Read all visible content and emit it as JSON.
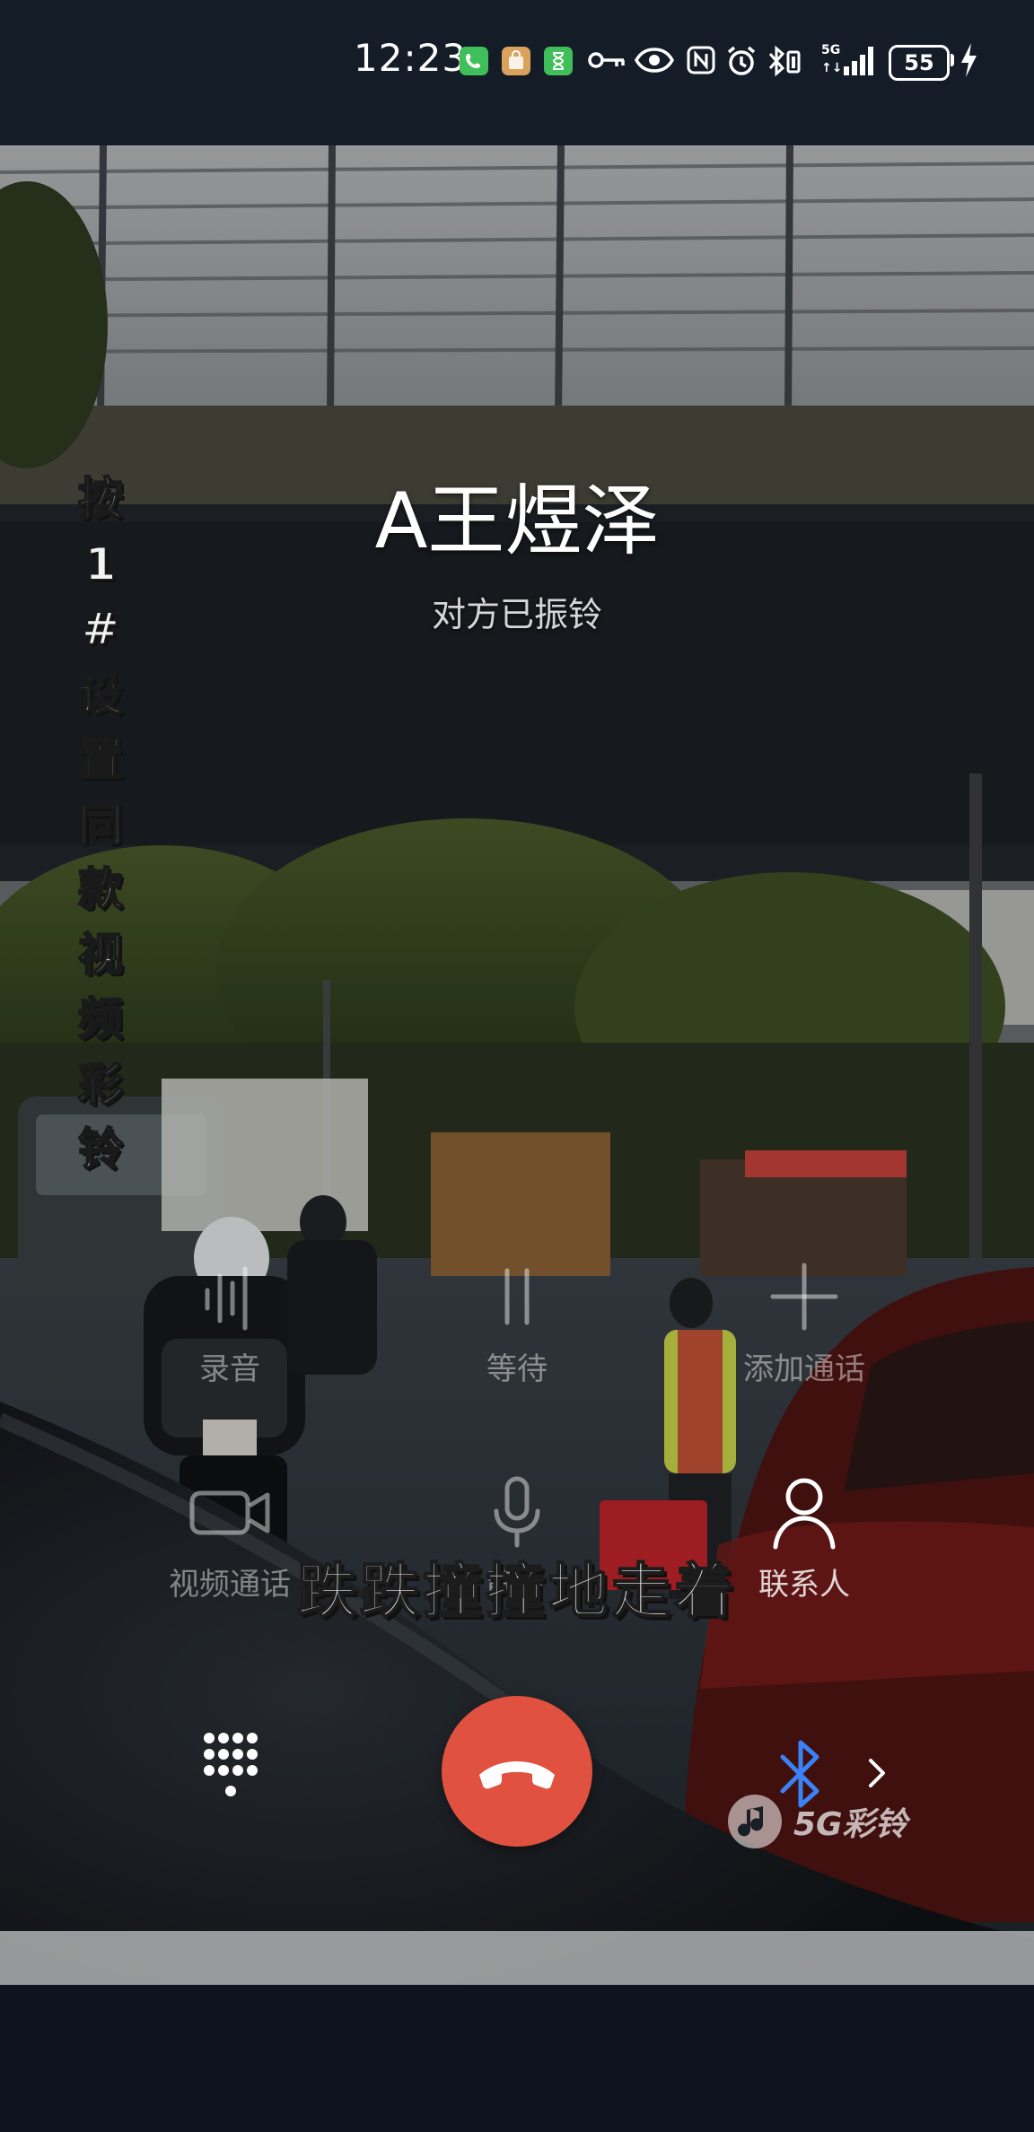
{
  "status_bar": {
    "time": "12:23",
    "network": "5G",
    "battery": "55"
  },
  "call": {
    "caller_name": "A王煜泽",
    "status": "对方已振铃"
  },
  "promo": {
    "vertical_text": "按\n1\n#\n设\n置\n同\n款\n视\n频\n彩\n铃",
    "lyric": "跌跌撞撞地走着",
    "brand": "5G彩铃"
  },
  "actions": [
    {
      "id": "record",
      "label": "录音",
      "icon": "waveform-icon",
      "enabled": false
    },
    {
      "id": "hold",
      "label": "等待",
      "icon": "pause-icon",
      "enabled": false
    },
    {
      "id": "add-call",
      "label": "添加通话",
      "icon": "plus-icon",
      "enabled": false
    },
    {
      "id": "video-call",
      "label": "视频通话",
      "icon": "video-camera-icon",
      "enabled": false
    },
    {
      "id": "mute",
      "label": "静音",
      "icon": "microphone-icon",
      "enabled": false
    },
    {
      "id": "contacts",
      "label": "联系人",
      "icon": "person-icon",
      "enabled": true
    }
  ],
  "colors": {
    "hangup": "#e0523f",
    "bluetooth": "#3b82f6",
    "background": "#111823"
  }
}
